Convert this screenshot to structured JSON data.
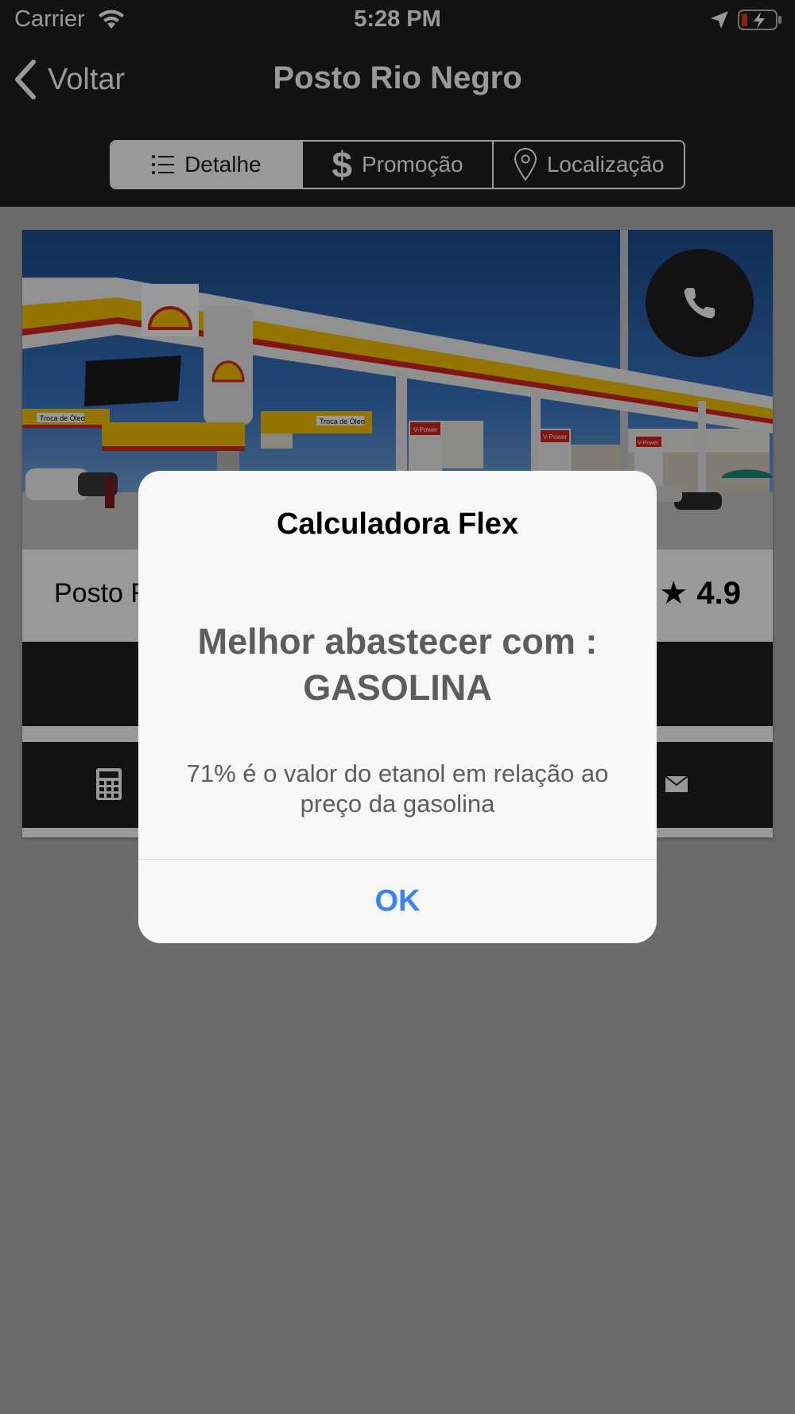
{
  "status_bar": {
    "carrier": "Carrier",
    "time": "5:28 PM",
    "icons": [
      "wifi-icon",
      "location-arrow-icon",
      "battery-charging-icon"
    ]
  },
  "navbar": {
    "back_label": "Voltar",
    "title": "Posto Rio Negro"
  },
  "tabs": [
    {
      "label": "Detalhe",
      "icon": "list-icon",
      "active": true
    },
    {
      "label": "Promoção",
      "icon": "dollar-icon",
      "active": false
    },
    {
      "label": "Localização",
      "icon": "map-pin-icon",
      "active": false
    }
  ],
  "station": {
    "name": "Posto Rio Negro",
    "rating": "★ 4.9",
    "photo_signs": [
      "Troca de Óleo",
      "Troca de Óleo",
      "V-Power",
      "V-Power",
      "V-Power"
    ]
  },
  "alert": {
    "title": "Calculadora Flex",
    "headline": "Melhor abastecer com : GASOLINA",
    "message": "71% é o valor do etanol em relação ao preço da gasolina",
    "button": "OK"
  },
  "colors": {
    "bar_dark": "#1e1e1e",
    "background": "#b3b3b3",
    "alert_bg": "#f7f7f7",
    "accent_blue": "#3b82f6",
    "shell_yellow": "#f5c400",
    "shell_red": "#d8261c"
  }
}
